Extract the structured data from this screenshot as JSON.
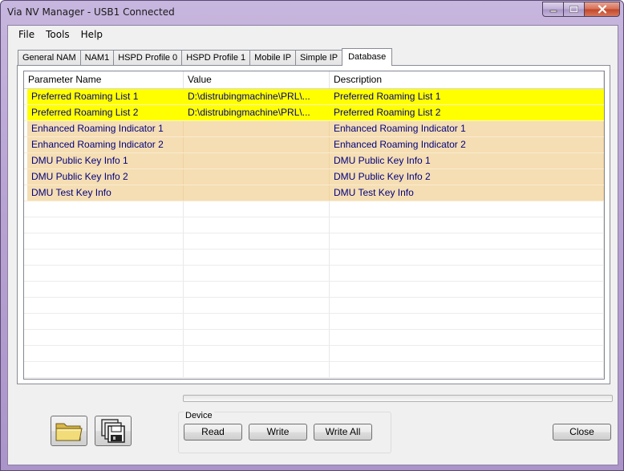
{
  "window": {
    "title": "Via NV Manager - USB1 Connected"
  },
  "menu": [
    "File",
    "Tools",
    "Help"
  ],
  "tabs": [
    "General NAM",
    "NAM1",
    "HSPD Profile 0",
    "HSPD Profile 1",
    "Mobile IP",
    "Simple IP",
    "Database"
  ],
  "active_tab": "Database",
  "table": {
    "headers": [
      "Parameter Name",
      "Value",
      "Description"
    ],
    "rows": [
      {
        "name": "Preferred Roaming List 1",
        "value": "D:\\distrubingmachine\\PRL\\...",
        "description": "Preferred Roaming List 1",
        "highlight": "yellow"
      },
      {
        "name": "Preferred Roaming List 2",
        "value": "D:\\distrubingmachine\\PRL\\...",
        "description": "Preferred Roaming List 2",
        "highlight": "yellow"
      },
      {
        "name": "Enhanced Roaming Indicator 1",
        "value": "",
        "description": "Enhanced Roaming Indicator 1",
        "highlight": "tan"
      },
      {
        "name": "Enhanced Roaming Indicator 2",
        "value": "",
        "description": "Enhanced Roaming Indicator 2",
        "highlight": "tan"
      },
      {
        "name": "DMU Public Key Info 1",
        "value": "",
        "description": "DMU Public Key Info 1",
        "highlight": "tan"
      },
      {
        "name": "DMU Public Key Info 2",
        "value": "",
        "description": "DMU Public Key Info 2",
        "highlight": "tan"
      },
      {
        "name": "DMU Test Key Info",
        "value": "",
        "description": "DMU Test Key Info",
        "highlight": "tan"
      }
    ],
    "empty_rows": 11,
    "colors": {
      "yellow": "#ffff00",
      "tan": "#f5deb3",
      "text": "#000080"
    }
  },
  "progress": {
    "value": 0
  },
  "device": {
    "legend": "Device",
    "read_label": "Read",
    "write_label": "Write",
    "write_all_label": "Write All"
  },
  "close_label": "Close",
  "icons": {
    "open": "folder-icon",
    "save": "floppy-disks-icon"
  }
}
